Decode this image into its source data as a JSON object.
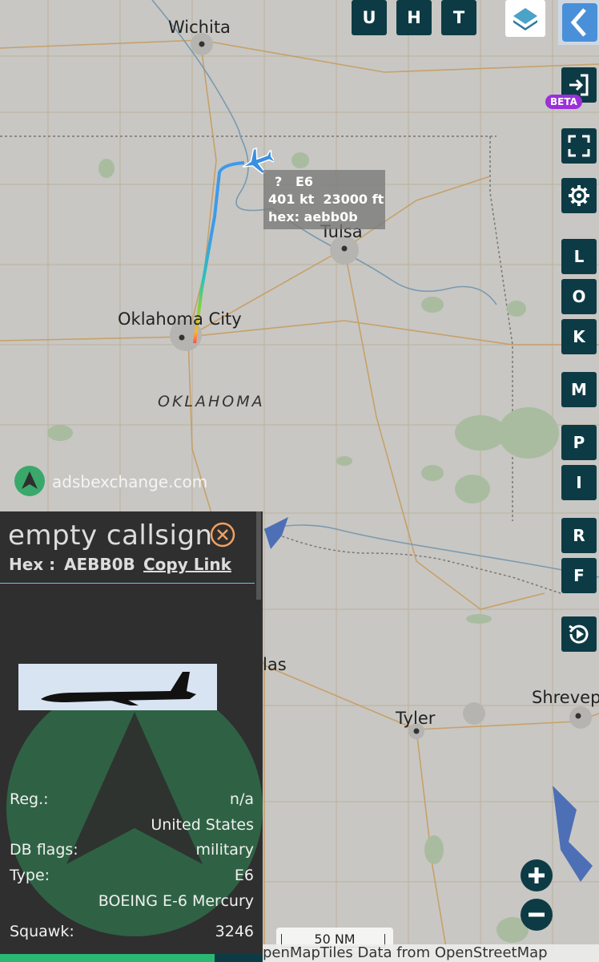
{
  "map": {
    "cities": [
      {
        "name": "Wichita"
      },
      {
        "name": "Tulsa"
      },
      {
        "name": "Oklahoma City"
      },
      {
        "name": "las"
      },
      {
        "name": "Tyler"
      },
      {
        "name": "Shrevep"
      }
    ],
    "state_label": "OKLAHOMA",
    "watermark": "adsbexchange.com",
    "scale": "50 NM",
    "attribution": "penMapTiles Data from OpenStreetMap"
  },
  "aircraft_label": {
    "line1": "?   E6",
    "line2": "401 kt  23000 ft",
    "line3": "hex: aebb0b"
  },
  "top_buttons": [
    "U",
    "H",
    "T"
  ],
  "beta_badge": "BETA",
  "side_buttons": [
    "L",
    "O",
    "K",
    "M",
    "P",
    "I",
    "R",
    "F"
  ],
  "panel": {
    "title": "empty callsign",
    "hex_label": "Hex :",
    "hex_value": "AEBB0B",
    "copy_link": "Copy Link",
    "rows": [
      {
        "key": "Reg.:",
        "value": "n/a"
      },
      {
        "key": "",
        "value": "United States"
      },
      {
        "key": "DB flags:",
        "value": "military"
      },
      {
        "key": "Type:",
        "value": "E6"
      },
      {
        "key": "",
        "value": "BOEING E-6 Mercury"
      },
      {
        "key": "Squawk:",
        "value": "3246"
      }
    ]
  },
  "colors": {
    "button_bg": "#0d3b45",
    "map_bg": "#c8c7c3",
    "panel_bg": "#2f2f2f",
    "accent": "#2bb673",
    "plane": "#3a8fe0",
    "beta": "#9b30d9"
  }
}
